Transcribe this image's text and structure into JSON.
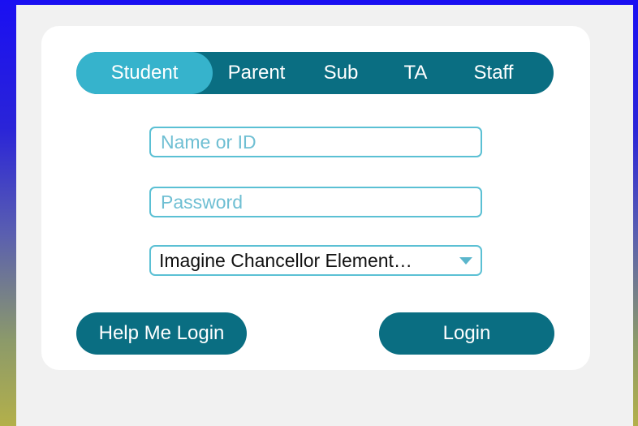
{
  "tabs": [
    {
      "label": "Student",
      "active": true
    },
    {
      "label": "Parent",
      "active": false
    },
    {
      "label": "Sub",
      "active": false
    },
    {
      "label": "TA",
      "active": false
    },
    {
      "label": "Staff",
      "active": false
    }
  ],
  "form": {
    "name_placeholder": "Name or ID",
    "password_placeholder": "Password",
    "school_selected": "Imagine Chancellor Element…"
  },
  "buttons": {
    "help_label": "Help Me Login",
    "login_label": "Login"
  },
  "colors": {
    "primary": "#0a6e82",
    "active_tab": "#36b3cc",
    "input_border": "#5bc0d4"
  }
}
